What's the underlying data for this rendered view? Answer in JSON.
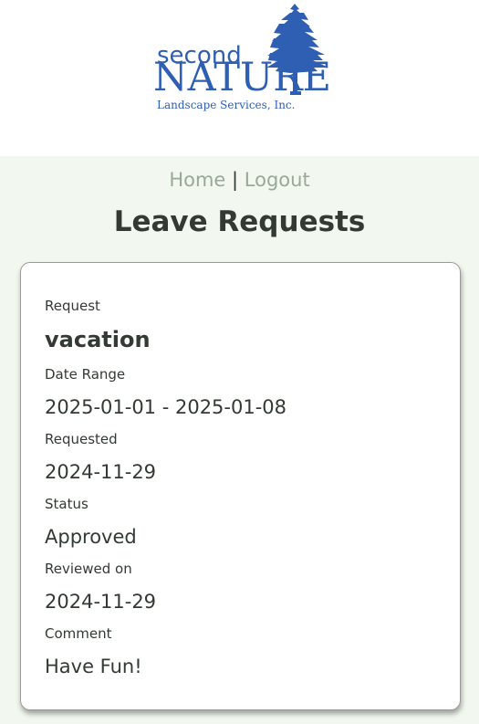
{
  "brand": {
    "line1": "second",
    "line2": "NATURE",
    "line3": "Landscape Services, Inc.",
    "color": "#2f5fb3",
    "icon": "pine-tree-icon"
  },
  "nav": {
    "home": "Home",
    "separator": "|",
    "logout": "Logout"
  },
  "page": {
    "title": "Leave Requests"
  },
  "request": {
    "request_label": "Request",
    "request_value": "vacation",
    "date_range_label": "Date Range",
    "date_range_value": "2025-01-01 - 2025-01-08",
    "requested_label": "Requested",
    "requested_value": "2024-11-29",
    "status_label": "Status",
    "status_value": "Approved",
    "reviewed_label": "Reviewed on",
    "reviewed_value": "2024-11-29",
    "comment_label": "Comment",
    "comment_value": "Have Fun!"
  }
}
